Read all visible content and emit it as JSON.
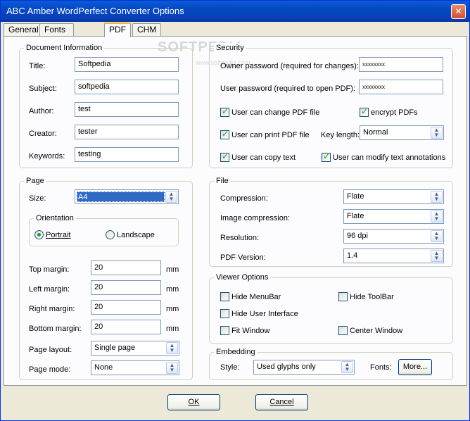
{
  "window": {
    "title": "ABC Amber WordPerfect Converter Options"
  },
  "tabs": [
    {
      "label": "General"
    },
    {
      "label": "Fonts and Colors"
    },
    {
      "label": "PDF"
    },
    {
      "label": "CHM & HLP"
    }
  ],
  "document_info": {
    "title": "Document Information",
    "fields": [
      {
        "label": "Title:",
        "value": "Softpedia"
      },
      {
        "label": "Subject:",
        "value": "softpedia"
      },
      {
        "label": "Author:",
        "value": "test"
      },
      {
        "label": "Creator:",
        "value": "tester"
      },
      {
        "label": "Keywords:",
        "value": "testing"
      }
    ]
  },
  "security": {
    "title": "Security",
    "owner_label": "Owner password (required for changes):",
    "owner_value": "xxxxxxxx",
    "user_label": "User password (required to open PDF):",
    "user_value": "xxxxxxxx",
    "change_label": "User can change PDF file",
    "encrypt_label": "encrypt PDFs",
    "print_label": "User can print PDF file",
    "keylength_label": "Key length:",
    "keylength_value": "Normal",
    "copy_label": "User can copy text",
    "modify_label": "User can modify text annotations"
  },
  "page": {
    "title": "Page",
    "size_label": "Size:",
    "size_value": "A4",
    "orientation_title": "Orientation",
    "portrait_label": "Portrait",
    "landscape_label": "Landscape",
    "margins": [
      {
        "label": "Top margin:",
        "value": "20",
        "unit": "mm"
      },
      {
        "label": "Left margin:",
        "value": "20",
        "unit": "mm"
      },
      {
        "label": "Right margin:",
        "value": "20",
        "unit": "mm"
      },
      {
        "label": "Bottom margin:",
        "value": "20",
        "unit": "mm"
      }
    ],
    "layout_label": "Page layout:",
    "layout_value": "Single page",
    "mode_label": "Page mode:",
    "mode_value": "None"
  },
  "file": {
    "title": "File",
    "rows": [
      {
        "label": "Compression:",
        "value": "Flate"
      },
      {
        "label": "Image compression:",
        "value": "Flate"
      },
      {
        "label": "Resolution:",
        "value": "96 dpi"
      },
      {
        "label": "PDF Version:",
        "value": "1.4"
      }
    ]
  },
  "viewer": {
    "title": "Viewer Options",
    "hide_menubar": "Hide MenuBar",
    "hide_toolbar": "Hide ToolBar",
    "hide_ui": "Hide User Interface",
    "fit_window": "Fit Window",
    "center_window": "Center Window"
  },
  "embedding": {
    "title": "Embedding",
    "style_label": "Style:",
    "style_value": "Used glyphs only",
    "fonts_label": "Fonts:",
    "more_label": "More..."
  },
  "buttons": {
    "ok": "OK",
    "cancel": "Cancel"
  },
  "watermark": {
    "main": "SOFTPEDIA",
    "small": "www.softpedia.com"
  }
}
